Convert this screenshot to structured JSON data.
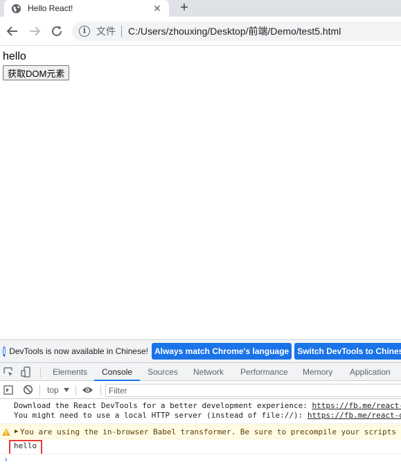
{
  "browser": {
    "tab_title": "Hello React!",
    "tab_close": "✕",
    "new_tab": "+",
    "omnibox_label": "文件",
    "url": "C:/Users/zhouxing/Desktop/前端/Demo/test5.html"
  },
  "page": {
    "heading": "hello",
    "button_label": "获取DOM元素"
  },
  "devtools": {
    "infobar_text": "DevTools is now available in Chinese!",
    "infobar_btn1": "Always match Chrome's language",
    "infobar_btn2": "Switch DevTools to Chinese",
    "tabs": [
      "Elements",
      "Console",
      "Sources",
      "Network",
      "Performance",
      "Memory",
      "Application"
    ],
    "active_tab": "Console",
    "context": "top",
    "filter_placeholder": "Filter",
    "messages": {
      "line1_text": "Download the React DevTools for a better development experience: ",
      "line1_link": "https://fb.me/react-devtools",
      "line2_text": "You might need to use a local HTTP server (instead of file://): ",
      "line2_link": "https://fb.me/react-devtools-faq",
      "warning": "You are using the in-browser Babel transformer. Be sure to precompile your scripts for production",
      "log": "hello",
      "prompt": "›"
    }
  }
}
